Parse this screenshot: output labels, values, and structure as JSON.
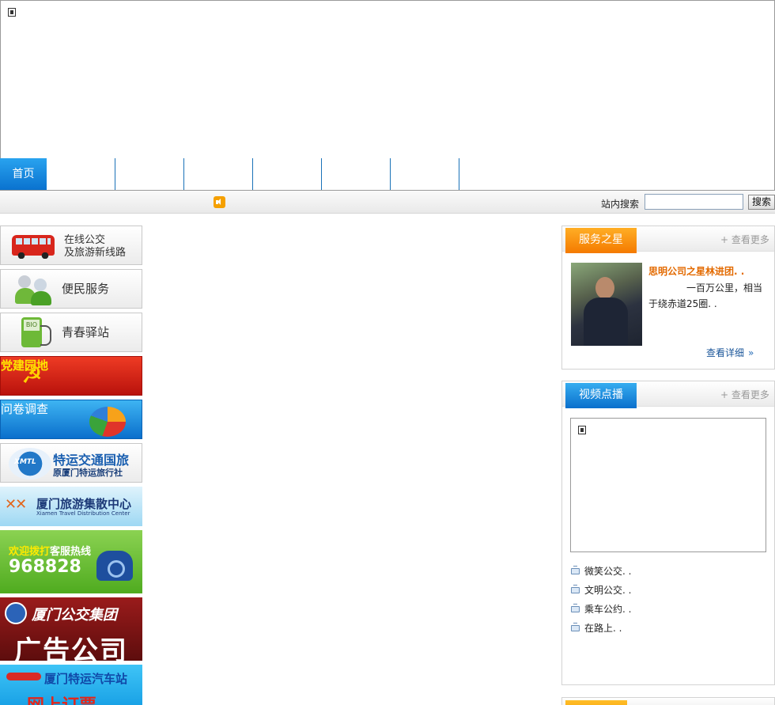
{
  "nav": {
    "home": "首页"
  },
  "toolbar": {
    "search_label": "站内搜索",
    "search_button": "搜索",
    "search_value": ""
  },
  "sidebar": {
    "bus": {
      "line1": "在线公交",
      "line2": "及旅游新线路"
    },
    "service": "便民服务",
    "youth": "青春驿站",
    "party": "党建园地",
    "survey": "问卷调查",
    "xmtl": {
      "logo": "XMTL",
      "title": "特运交通国旅",
      "subtitle": "原厦门特运旅行社"
    },
    "travel": {
      "title": "厦门旅游集散中心",
      "subtitle": "Xiamen Travel Distribution Center"
    },
    "hotline": {
      "welcome": "欢迎拨打",
      "label": "客服热线",
      "number": "968828"
    },
    "ad": {
      "title": "厦门公交集团",
      "subtitle": "广告公司"
    },
    "station": {
      "title": "厦门特运汽车站",
      "subtitle": "网上订票"
    }
  },
  "star_panel": {
    "tab": "服务之星",
    "more": "+ 查看更多",
    "title": "思明公司之星林进团. .",
    "desc": "一百万公里，相当于绕赤道25圈. .",
    "detail": "查看详细"
  },
  "video_panel": {
    "tab": "视频点播",
    "more": "+ 查看更多",
    "items": [
      "微笑公交. .",
      "文明公交. .",
      "乘车公约. .",
      "在路上. ."
    ]
  },
  "colors": {
    "accent_blue": "#0a72cf",
    "accent_orange": "#f47a00",
    "party_red": "#c8160e"
  }
}
